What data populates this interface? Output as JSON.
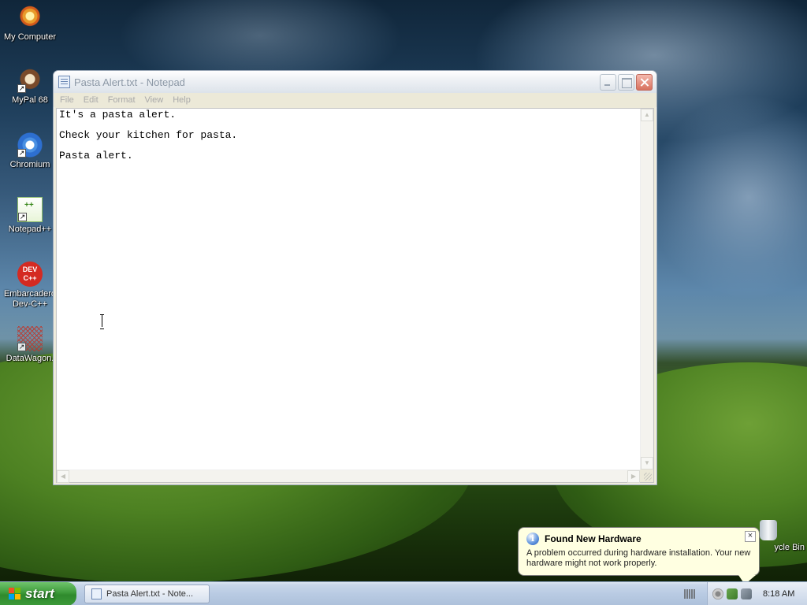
{
  "desktop": {
    "icons": [
      {
        "label": "My Computer",
        "icon": "my-computer-icon"
      },
      {
        "label": "MyPal 68",
        "icon": "mypal-browser-icon"
      },
      {
        "label": "Chromium",
        "icon": "chromium-icon"
      },
      {
        "label": "Notepad++",
        "icon": "notepad-plus-plus-icon"
      },
      {
        "label": "Embarcadero Dev-C++",
        "icon": "dev-cpp-icon",
        "badge": "DEV C++"
      },
      {
        "label": "DataWagon.",
        "icon": "datawagon-icon"
      },
      {
        "label": "ycle Bin",
        "icon": "recycle-bin-icon"
      }
    ]
  },
  "notepad": {
    "title": "Pasta Alert.txt - Notepad",
    "menu": [
      "File",
      "Edit",
      "Format",
      "View",
      "Help"
    ],
    "lines": [
      "It's a pasta alert.",
      "Check your kitchen for pasta.",
      "Pasta alert."
    ]
  },
  "balloon": {
    "title": "Found New Hardware",
    "body": "A problem occurred during hardware installation. Your new hardware might not work properly.",
    "close": "×"
  },
  "taskbar": {
    "start_label": "start",
    "task_label": "Pasta Alert.txt - Note...",
    "clock": "8:18 AM"
  },
  "colors": {
    "start_green": "#3d9a3a",
    "balloon_bg": "#ffffe1",
    "taskbar_blue": "#b9cbe3"
  }
}
